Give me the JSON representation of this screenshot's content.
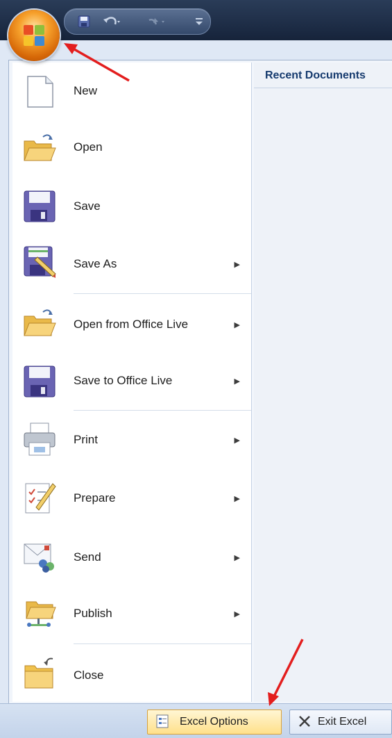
{
  "quick_access": {
    "save_icon": "save-icon",
    "undo_icon": "undo-icon",
    "redo_icon": "redo-icon",
    "customize_icon": "customize-qat-icon"
  },
  "office_button": {
    "icon": "office-logo-icon"
  },
  "recent": {
    "heading": "Recent Documents"
  },
  "menu": {
    "items": [
      {
        "label": "New",
        "icon": "new-document-icon",
        "submenu": false
      },
      {
        "label": "Open",
        "icon": "open-folder-icon",
        "submenu": false
      },
      {
        "label": "Save",
        "icon": "floppy-disk-icon",
        "submenu": false
      },
      {
        "label": "Save As",
        "icon": "save-as-icon",
        "submenu": true
      },
      {
        "label": "Open from Office Live",
        "icon": "open-folder-icon",
        "submenu": true
      },
      {
        "label": "Save to Office Live",
        "icon": "floppy-disk-icon",
        "submenu": true
      },
      {
        "label": "Print",
        "icon": "printer-icon",
        "submenu": true
      },
      {
        "label": "Prepare",
        "icon": "prepare-document-icon",
        "submenu": true
      },
      {
        "label": "Send",
        "icon": "send-icon",
        "submenu": true
      },
      {
        "label": "Publish",
        "icon": "publish-folder-icon",
        "submenu": true
      },
      {
        "label": "Close",
        "icon": "close-folder-icon",
        "submenu": false
      }
    ]
  },
  "bottom": {
    "options_label": "Excel Options",
    "exit_label": "Exit Excel"
  },
  "colors": {
    "accent": "#e31e1e",
    "options_highlight": "#ffe08a",
    "heading": "#153a6e"
  }
}
